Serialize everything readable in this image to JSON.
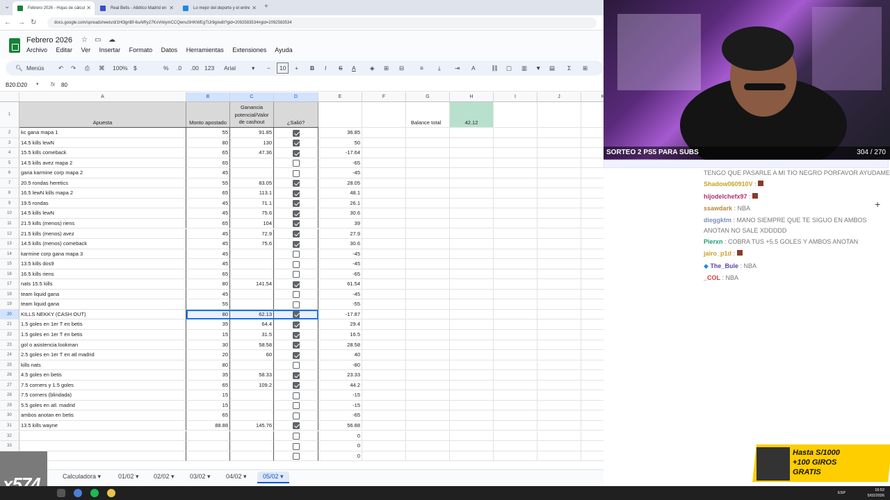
{
  "browser": {
    "tabs": [
      {
        "label": "Febrero 2026 - Hojas de cálcul",
        "color": "#188038"
      },
      {
        "label": "Real Betis - Atlético Madrid en",
        "color": "#3b4dc8"
      },
      {
        "label": "Lo mejor del deporte y el entre",
        "color": "#1e88e5"
      }
    ],
    "url": "docs.google.com/spreadsheets/d/1Hl3gnBf-6uAlRy27KxVrklymCCQwnuSHKWEgTlJr9g/edit?gid=2092583534#gid=2092583534"
  },
  "doc": {
    "title": "Febrero 2026",
    "menus": [
      "Archivo",
      "Editar",
      "Ver",
      "Insertar",
      "Formato",
      "Datos",
      "Herramientas",
      "Extensiones",
      "Ayuda"
    ]
  },
  "toolbar": {
    "search": "Menús",
    "zoom": "100%",
    "currency": "$",
    "percent": "%",
    "dec_less": ".0",
    "dec_more": ".00",
    "num_format": "123",
    "font": "Arial",
    "font_size": "10"
  },
  "formula_bar": {
    "cell_ref": "B20:D20",
    "fx": "fx",
    "value": "80"
  },
  "columns": [
    "A",
    "B",
    "C",
    "D",
    "E",
    "F",
    "G",
    "H",
    "I",
    "J",
    "K"
  ],
  "header_row": {
    "apuesta": "Apuesta",
    "monto": "Monto apostado",
    "ganancia": "Ganancia potencial/Valor de cashout",
    "salio": "¿Salió?",
    "balance_label": "Balance total",
    "balance_value": "42.12"
  },
  "rows": [
    {
      "n": "2",
      "a": "kc gana mapa 1",
      "b": "55",
      "c": "91.85",
      "d": true,
      "e": "36.85"
    },
    {
      "n": "3",
      "a": "14.5 kills lewN",
      "b": "80",
      "c": "130",
      "d": true,
      "e": "50"
    },
    {
      "n": "4",
      "a": "15.5 kills comeback",
      "b": "65",
      "c": "47.36",
      "d": true,
      "e": "-17.64"
    },
    {
      "n": "5",
      "a": "14.5 kills avez mapa 2",
      "b": "65",
      "c": "",
      "d": false,
      "e": "-65"
    },
    {
      "n": "6",
      "a": "gana karmine corp mapa 2",
      "b": "45",
      "c": "",
      "d": false,
      "e": "-45"
    },
    {
      "n": "7",
      "a": "20.5 rondas heretics",
      "b": "55",
      "c": "83.05",
      "d": true,
      "e": "28.05"
    },
    {
      "n": "8",
      "a": "16.5 lewN kills mapa 2",
      "b": "65",
      "c": "113.1",
      "d": true,
      "e": "48.1"
    },
    {
      "n": "9",
      "a": "19.5 rondas",
      "b": "45",
      "c": "71.1",
      "d": true,
      "e": "26.1"
    },
    {
      "n": "10",
      "a": "14.5 kills lewN",
      "b": "45",
      "c": "75.6",
      "d": true,
      "e": "30.6"
    },
    {
      "n": "11",
      "a": "21.5 kills (menos) riens",
      "b": "65",
      "c": "104",
      "d": true,
      "e": "39"
    },
    {
      "n": "12",
      "a": "21.5 kills (menos) avez",
      "b": "45",
      "c": "72.9",
      "d": true,
      "e": "27.9"
    },
    {
      "n": "13",
      "a": "14.5 kills (menos) comeback",
      "b": "45",
      "c": "75.6",
      "d": true,
      "e": "30.6"
    },
    {
      "n": "14",
      "a": "karmine corp gana mapa 3",
      "b": "45",
      "c": "",
      "d": false,
      "e": "-45"
    },
    {
      "n": "15",
      "a": "13.5 kills dos9",
      "b": "45",
      "c": "",
      "d": false,
      "e": "-45"
    },
    {
      "n": "16",
      "a": "16.5 kills riens",
      "b": "65",
      "c": "",
      "d": false,
      "e": "-65"
    },
    {
      "n": "17",
      "a": "nats 15.5 kills",
      "b": "80",
      "c": "141.54",
      "d": true,
      "e": "61.54"
    },
    {
      "n": "18",
      "a": "team liquid gana",
      "b": "45",
      "c": "",
      "d": false,
      "e": "-45"
    },
    {
      "n": "19",
      "a": "team liquid gana",
      "b": "55",
      "c": "",
      "d": false,
      "e": "-55"
    },
    {
      "n": "20",
      "a": "KILLS NEKKY (CASH OUT)",
      "b": "80",
      "c": "62.13",
      "d": true,
      "e": "-17.87"
    },
    {
      "n": "21",
      "a": "1.5 goles en 1er T en betis",
      "b": "35",
      "c": "64.4",
      "d": true,
      "e": "29.4"
    },
    {
      "n": "22",
      "a": "1.5 goles en 1er T en betis",
      "b": "15",
      "c": "31.5",
      "d": true,
      "e": "16.5"
    },
    {
      "n": "23",
      "a": "gol o asistencia lookman",
      "b": "30",
      "c": "58.58",
      "d": true,
      "e": "28.58"
    },
    {
      "n": "24",
      "a": "2.5 goles en 1er T en atl madrid",
      "b": "20",
      "c": "60",
      "d": true,
      "e": "40"
    },
    {
      "n": "25",
      "a": "kills nats",
      "b": "80",
      "c": "",
      "d": false,
      "e": "-80"
    },
    {
      "n": "26",
      "a": "4.5 goles en betis",
      "b": "35",
      "c": "58.33",
      "d": true,
      "e": "23.33"
    },
    {
      "n": "27",
      "a": "7.5 corners y 1.5 goles",
      "b": "65",
      "c": "109.2",
      "d": true,
      "e": "44.2"
    },
    {
      "n": "28",
      "a": "7.5 corners (blindada)",
      "b": "15",
      "c": "",
      "d": false,
      "e": "-15"
    },
    {
      "n": "29",
      "a": "5.5 goles en atl. madrid",
      "b": "15",
      "c": "",
      "d": false,
      "e": "-15"
    },
    {
      "n": "30",
      "a": "ambos anotan en betis",
      "b": "65",
      "c": "",
      "d": false,
      "e": "-65"
    },
    {
      "n": "31",
      "a": "13.5 kills wayne",
      "b": "88.88",
      "c": "145.76",
      "d": true,
      "e": "56.88"
    },
    {
      "n": "32",
      "a": "",
      "b": "",
      "c": "",
      "d": false,
      "e": "0"
    },
    {
      "n": "33",
      "a": "",
      "b": "",
      "c": "",
      "d": false,
      "e": "0"
    },
    {
      "n": "34",
      "a": "",
      "b": "",
      "c": "",
      "d": false,
      "e": "0"
    }
  ],
  "sheet_tabs": [
    "Calculadora",
    "01/02",
    "02/02",
    "03/02",
    "04/02",
    "05/02"
  ],
  "active_sheet": "05/02",
  "stream": {
    "banner": "SORTEO 2 PS5 PARA SUBS",
    "counter": "304  /  270",
    "chat": [
      {
        "user": "",
        "text": "TENGO QUE PASARLE A MI TIO NEGRO PORFAVOR AYUDAME",
        "color": "#888888"
      },
      {
        "user": "Shadow060910V",
        "text": "",
        "color": "#c9a227"
      },
      {
        "user": "hijodelchefx97",
        "text": "",
        "color": "#b2306e"
      },
      {
        "user": "ssawdark",
        "text": ": NBA",
        "color": "#b58b3a"
      },
      {
        "user": "dieggktm",
        "text": ": MANO SIEMPRE QUE TE SIGUO EN AMBOS ANOTAN NO SALE XDDDDD",
        "color": "#7f8fb5"
      },
      {
        "user": "Pierxn",
        "text": ": COBRA TUS +5.5 GOLES Y AMBOS ANOTAN",
        "color": "#1f9e75"
      },
      {
        "user": "jairo_p1d",
        "text": "",
        "color": "#c9a227"
      },
      {
        "user": "The_Bule",
        "text": ": NBA",
        "color": "#6441a5"
      },
      {
        "user": "_COL",
        "text": ": NBA",
        "color": "#d23b3b"
      }
    ],
    "promo": {
      "line1": "Hasta S/1000",
      "line2": "+100 GIROS",
      "line3": "GRATIS"
    },
    "overlay_tag": "x574"
  },
  "tray": {
    "time": "16:52",
    "date": "5/02/2026",
    "lang": "ESP"
  }
}
